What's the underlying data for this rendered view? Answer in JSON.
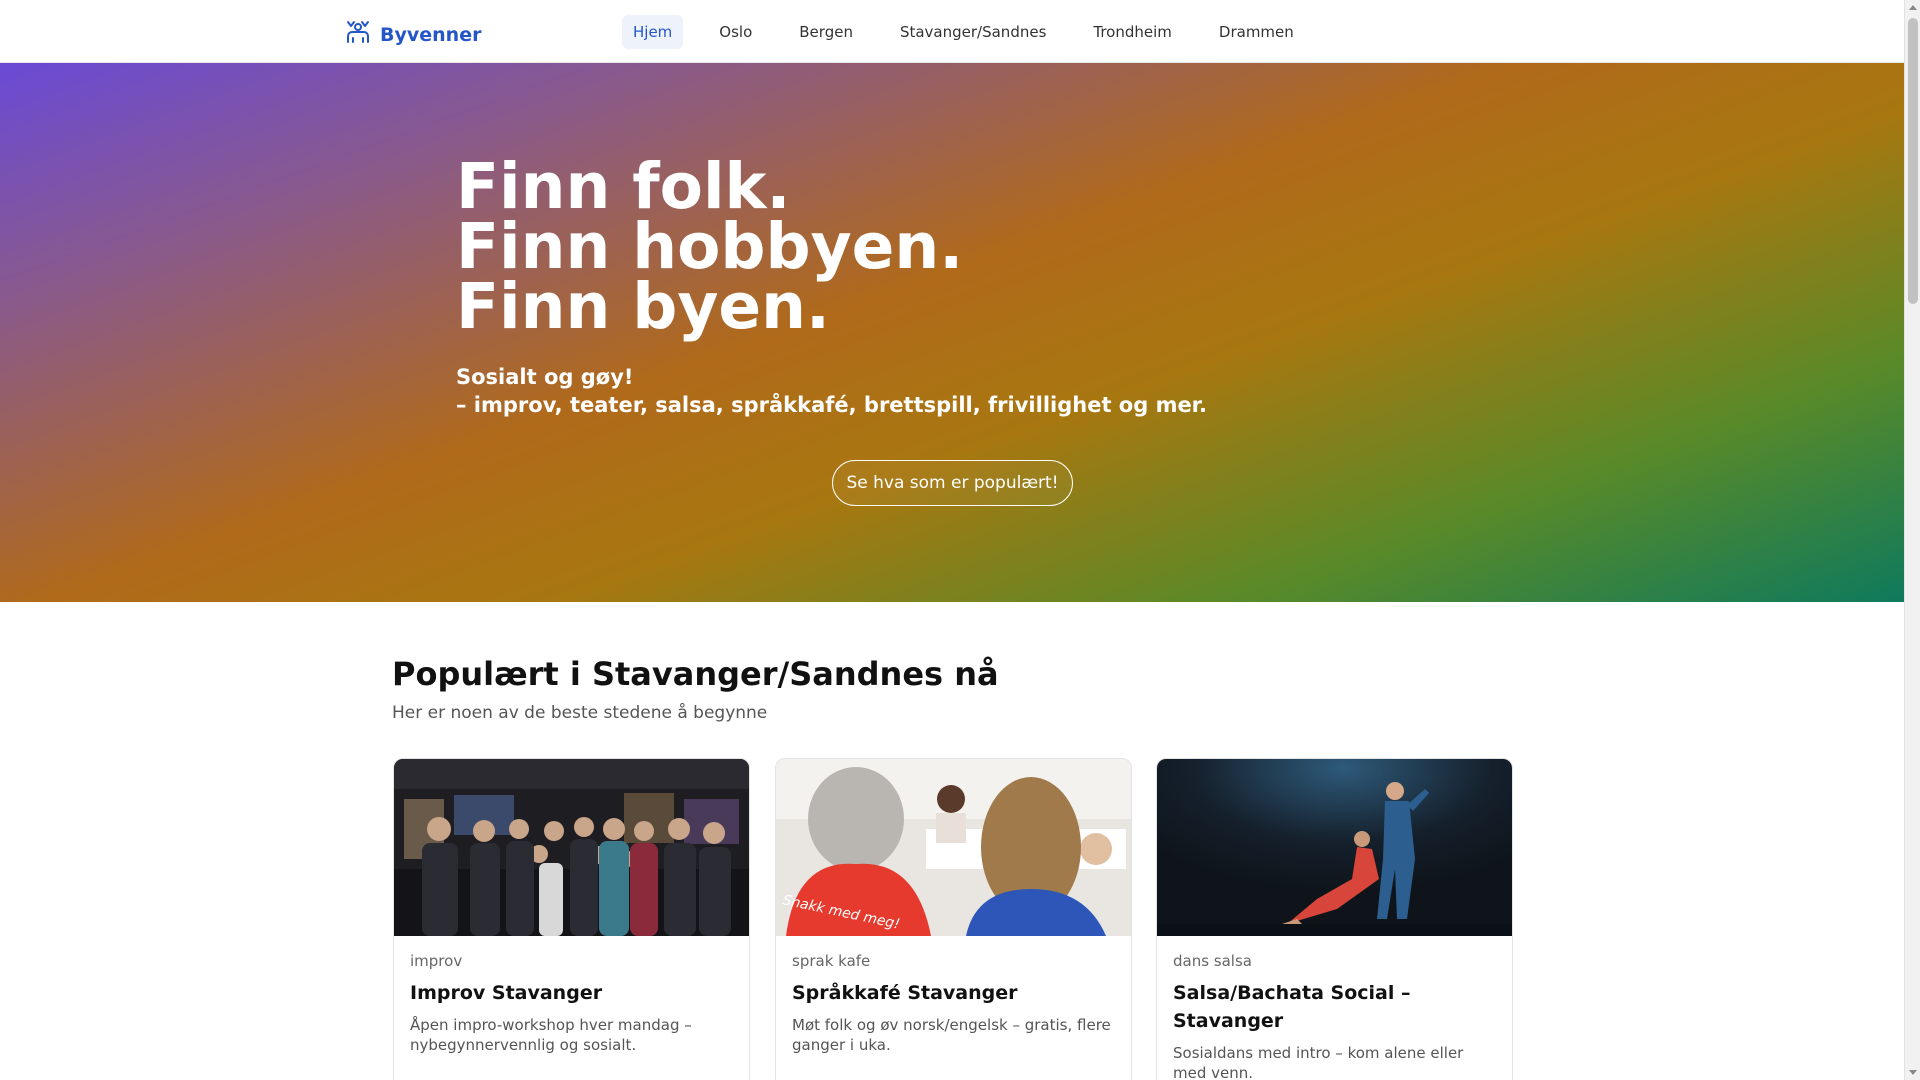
{
  "brand": {
    "name": "Byvenner",
    "icon": "people-icon",
    "color": "#2456c7"
  },
  "nav": {
    "items": [
      {
        "label": "Hjem",
        "active": true
      },
      {
        "label": "Oslo"
      },
      {
        "label": "Bergen"
      },
      {
        "label": "Stavanger/Sandnes"
      },
      {
        "label": "Trondheim"
      },
      {
        "label": "Drammen"
      }
    ]
  },
  "hero": {
    "title_lines": [
      "Finn folk.",
      "Finn hobbyen.",
      "Finn byen."
    ],
    "subtitle_lines": [
      "Sosialt og gøy!",
      "– improv, teater, salsa, språkkafé, brettspill, frivillighet og mer."
    ],
    "cta_label": "Se hva som er populært!"
  },
  "section": {
    "title": "Populært i Stavanger/Sandnes nå",
    "subtitle": "Her er noen av de beste stedene å begynne"
  },
  "cards": [
    {
      "tag": "improv",
      "title": "Improv Stavanger",
      "description": "Åpen impro-workshop hver mandag – nybegynnervennlig og sosialt.",
      "image": "group-photo"
    },
    {
      "tag": "sprak kafe",
      "title": "Språkkafé Stavanger",
      "description": "Møt folk og øv norsk/engelsk – gratis, flere ganger i uka.",
      "image": "cafe-photo",
      "shirt_text": "Snakk med meg!"
    },
    {
      "tag": "dans salsa",
      "title": "Salsa/Bachata Social – Stavanger",
      "description": "Sosialdans med intro – kom alene eller med venn.",
      "image": "dance-photo"
    }
  ]
}
